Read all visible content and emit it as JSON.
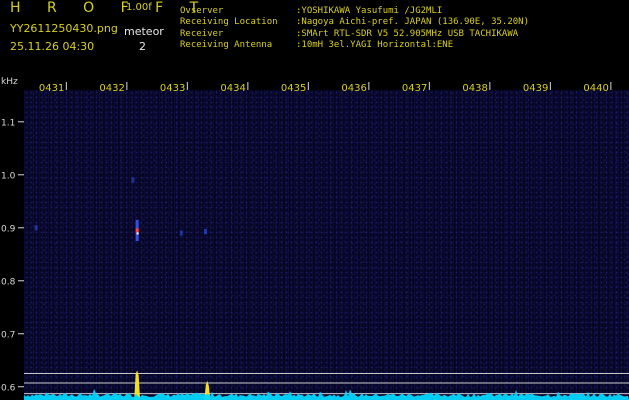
{
  "header": {
    "app_title": "H R O F F T",
    "version": "1.00f",
    "filename": "YY2611250430.png",
    "timestamp": "25.11.26 04:30",
    "mode_label": "meteor",
    "count": "2"
  },
  "station_info": [
    {
      "label": "Ovserver",
      "value": ":YOSHIKAWA Yasufumi /JG2MLI"
    },
    {
      "label": "Receiving Location",
      "value": ":Nagoya Aichi-pref. JAPAN (136.90E, 35.20N)"
    },
    {
      "label": "Receiver",
      "value": ":SMArt RTL-SDR V5 52.905MHz USB TACHIKAWA"
    },
    {
      "label": "Receiving Antenna",
      "value": ":10mH 3el.YAGI Horizontal:ENE"
    }
  ],
  "colors": {
    "header_text": "#d8d020",
    "axis_text": "#d8d8d8",
    "background": "#060624",
    "spectrum": "#00d8ff",
    "detection": "#f0e020",
    "meteor_echo": "#ff4040"
  },
  "chart_data": {
    "type": "heatmap",
    "ylabel": "kHz",
    "y_ticks": [
      "1.1",
      "1.0",
      "0.9",
      "0.8",
      "0.7",
      "0.6"
    ],
    "y_tick_values": [
      1.1,
      1.0,
      0.9,
      0.8,
      0.7,
      0.6
    ],
    "ylim": [
      0.575,
      1.16
    ],
    "x_ticks": [
      "0431",
      "0432",
      "0433",
      "0434",
      "0435",
      "0436",
      "0437",
      "0438",
      "0439",
      "0440"
    ],
    "x_tick_values": [
      1,
      2,
      3,
      4,
      5,
      6,
      7,
      8,
      9,
      10
    ],
    "xlim": [
      0.3,
      10.3
    ],
    "reference_lines": [
      0.625,
      0.607,
      0.587
    ],
    "meteor_echoes": [
      {
        "time": 2.17,
        "freq_center": 0.895,
        "freq_span": 0.04,
        "level": 1.0
      },
      {
        "time": 3.3,
        "freq_center": 0.893,
        "freq_span": 0.01,
        "level": 0.4
      },
      {
        "time": 0.5,
        "freq_center": 0.9,
        "freq_span": 0.01,
        "level": 0.3
      },
      {
        "time": 2.9,
        "freq_center": 0.89,
        "freq_span": 0.01,
        "level": 0.25
      },
      {
        "time": 2.1,
        "freq_center": 0.99,
        "freq_span": 0.01,
        "level": 0.25
      }
    ],
    "detections": [
      {
        "time": 2.17,
        "level": 0.85
      },
      {
        "time": 3.33,
        "level": 0.55
      }
    ]
  }
}
